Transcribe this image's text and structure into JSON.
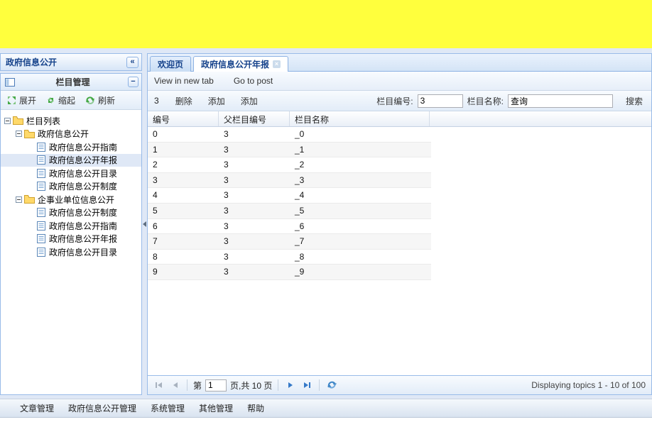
{
  "colors": {
    "banner_yellow": "#ffff3d",
    "accent_border": "#99bbe8",
    "header_text": "#15428b",
    "toolbar_icon_green": "#45a945",
    "paging_icon_blue": "#3579c8"
  },
  "sidebar": {
    "title": "政府信息公开",
    "collapse_glyph": "«",
    "panel": {
      "title": "栏目管理",
      "minimize_glyph": "−",
      "toolbar": {
        "expand_label": "展开",
        "collapse_label": "缩起",
        "refresh_label": "刷新"
      }
    },
    "tree": [
      {
        "label": "栏目列表"
      },
      {
        "label": "政府信息公开"
      },
      {
        "label": "政府信息公开指南"
      },
      {
        "label": "政府信息公开年报",
        "selected": true
      },
      {
        "label": "政府信息公开目录"
      },
      {
        "label": "政府信息公开制度"
      },
      {
        "label": "企事业单位信息公开"
      },
      {
        "label": "政府信息公开制度"
      },
      {
        "label": "政府信息公开指南"
      },
      {
        "label": "政府信息公开年报"
      },
      {
        "label": "政府信息公开目录"
      }
    ]
  },
  "main": {
    "tabs": [
      {
        "label": "欢迎页",
        "active": false
      },
      {
        "label": "政府信息公开年报",
        "active": true,
        "close_glyph": "×"
      }
    ],
    "link_toolbar": {
      "view_label": "View in new tab",
      "post_label": "Go to post"
    },
    "action_toolbar": {
      "count_label": "3",
      "delete_label": "删除",
      "add1_label": "添加",
      "add2_label": "添加",
      "col_id_label": "栏目编号:",
      "col_id_value": "3",
      "col_name_label": "栏目名称:",
      "col_name_value": "查询",
      "search_label": "搜索"
    },
    "grid": {
      "columns": [
        "编号",
        "父栏目编号",
        "栏目名称"
      ],
      "rows": [
        [
          "0",
          "3",
          "_0"
        ],
        [
          "1",
          "3",
          "_1"
        ],
        [
          "2",
          "3",
          "_2"
        ],
        [
          "3",
          "3",
          "_3"
        ],
        [
          "4",
          "3",
          "_4"
        ],
        [
          "5",
          "3",
          "_5"
        ],
        [
          "6",
          "3",
          "_6"
        ],
        [
          "7",
          "3",
          "_7"
        ],
        [
          "8",
          "3",
          "_8"
        ],
        [
          "9",
          "3",
          "_9"
        ]
      ]
    },
    "paging": {
      "page_prefix": "第",
      "page_value": "1",
      "page_suffix": "页,共 10 页",
      "status": "Displaying topics 1 - 10 of 100"
    }
  },
  "menubar": {
    "items": [
      "文章管理",
      "政府信息公开管理",
      "系统管理",
      "其他管理",
      "帮助"
    ]
  }
}
